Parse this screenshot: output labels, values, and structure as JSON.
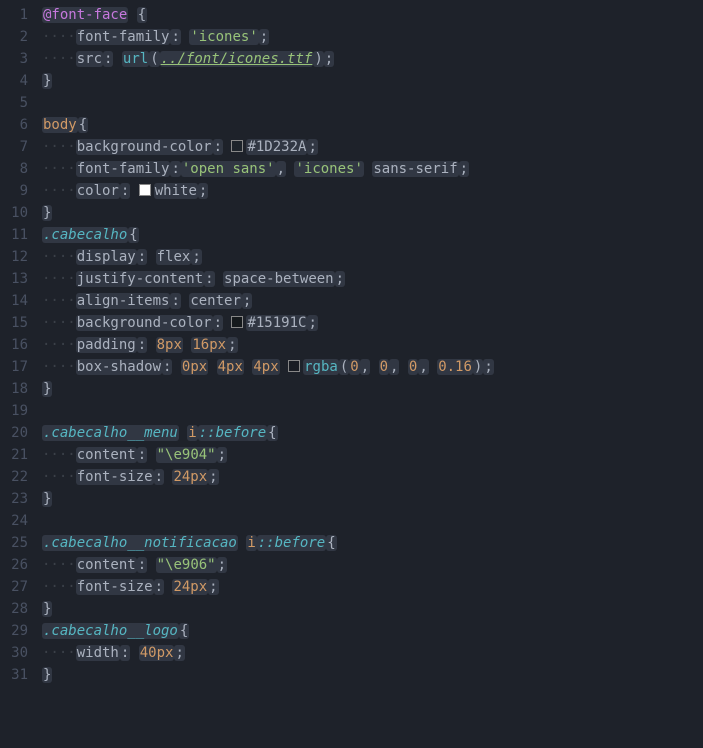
{
  "lines": [
    {
      "n": "1",
      "tokens": [
        {
          "t": "@font-face",
          "c": "kw"
        },
        {
          "t": " ",
          "c": "ws"
        },
        {
          "t": "{",
          "c": "brace"
        }
      ]
    },
    {
      "n": "2",
      "tokens": [
        {
          "t": "····",
          "c": "ws",
          "ind": true
        },
        {
          "t": "font-family",
          "c": "prop"
        },
        {
          "t": ":",
          "c": "punct"
        },
        {
          "t": " ",
          "c": "ws"
        },
        {
          "t": "'icones'",
          "c": "str"
        },
        {
          "t": ";",
          "c": "punct"
        }
      ]
    },
    {
      "n": "3",
      "tokens": [
        {
          "t": "····",
          "c": "ws",
          "ind": true
        },
        {
          "t": "src",
          "c": "prop"
        },
        {
          "t": ":",
          "c": "punct"
        },
        {
          "t": " ",
          "c": "ws"
        },
        {
          "t": "url",
          "c": "fn"
        },
        {
          "t": "(",
          "c": "punct"
        },
        {
          "t": "../font/icones.ttf",
          "c": "url"
        },
        {
          "t": ")",
          "c": "punct"
        },
        {
          "t": ";",
          "c": "punct"
        }
      ]
    },
    {
      "n": "4",
      "tokens": [
        {
          "t": "}",
          "c": "brace"
        }
      ]
    },
    {
      "n": "5",
      "tokens": []
    },
    {
      "n": "6",
      "tokens": [
        {
          "t": "body",
          "c": "sel"
        },
        {
          "t": "{",
          "c": "brace"
        }
      ]
    },
    {
      "n": "7",
      "tokens": [
        {
          "t": "····",
          "c": "ws",
          "ind": true
        },
        {
          "t": "background-color",
          "c": "prop"
        },
        {
          "t": ":",
          "c": "punct"
        },
        {
          "t": " ",
          "c": "ws"
        },
        {
          "sw": "#1D232A"
        },
        {
          "t": "#1D232A",
          "c": "val"
        },
        {
          "t": ";",
          "c": "punct"
        }
      ]
    },
    {
      "n": "8",
      "tokens": [
        {
          "t": "····",
          "c": "ws",
          "ind": true
        },
        {
          "t": "font-family",
          "c": "prop"
        },
        {
          "t": ":",
          "c": "punct"
        },
        {
          "t": "'open sans'",
          "c": "str"
        },
        {
          "t": ",",
          "c": "punct"
        },
        {
          "t": " ",
          "c": "ws"
        },
        {
          "t": "'icones'",
          "c": "str"
        },
        {
          "t": " ",
          "c": "ws"
        },
        {
          "t": "sans-serif",
          "c": "val"
        },
        {
          "t": ";",
          "c": "punct"
        }
      ]
    },
    {
      "n": "9",
      "tokens": [
        {
          "t": "····",
          "c": "ws",
          "ind": true
        },
        {
          "t": "color",
          "c": "prop"
        },
        {
          "t": ":",
          "c": "punct"
        },
        {
          "t": " ",
          "c": "ws"
        },
        {
          "sw": "#ffffff"
        },
        {
          "t": "white",
          "c": "val"
        },
        {
          "t": ";",
          "c": "punct"
        }
      ]
    },
    {
      "n": "10",
      "tokens": [
        {
          "t": "}",
          "c": "brace"
        }
      ]
    },
    {
      "n": "11",
      "tokens": [
        {
          "t": ".cabecalho",
          "c": "class"
        },
        {
          "t": "{",
          "c": "brace"
        }
      ]
    },
    {
      "n": "12",
      "tokens": [
        {
          "t": "····",
          "c": "ws",
          "ind": true
        },
        {
          "t": "display",
          "c": "prop"
        },
        {
          "t": ":",
          "c": "punct"
        },
        {
          "t": " ",
          "c": "ws"
        },
        {
          "t": "flex",
          "c": "val"
        },
        {
          "t": ";",
          "c": "punct"
        }
      ]
    },
    {
      "n": "13",
      "tokens": [
        {
          "t": "····",
          "c": "ws",
          "ind": true
        },
        {
          "t": "justify-content",
          "c": "prop"
        },
        {
          "t": ":",
          "c": "punct"
        },
        {
          "t": " ",
          "c": "ws"
        },
        {
          "t": "space-between",
          "c": "val"
        },
        {
          "t": ";",
          "c": "punct"
        }
      ]
    },
    {
      "n": "14",
      "tokens": [
        {
          "t": "····",
          "c": "ws",
          "ind": true
        },
        {
          "t": "align-items",
          "c": "prop"
        },
        {
          "t": ":",
          "c": "punct"
        },
        {
          "t": " ",
          "c": "ws"
        },
        {
          "t": "center",
          "c": "val"
        },
        {
          "t": ";",
          "c": "punct"
        }
      ]
    },
    {
      "n": "15",
      "tokens": [
        {
          "t": "····",
          "c": "ws",
          "ind": true
        },
        {
          "t": "background-color",
          "c": "prop"
        },
        {
          "t": ":",
          "c": "punct"
        },
        {
          "t": " ",
          "c": "ws"
        },
        {
          "sw": "#15191C"
        },
        {
          "t": "#15191C",
          "c": "val"
        },
        {
          "t": ";",
          "c": "punct"
        }
      ]
    },
    {
      "n": "16",
      "tokens": [
        {
          "t": "····",
          "c": "ws",
          "ind": true
        },
        {
          "t": "padding",
          "c": "prop"
        },
        {
          "t": ":",
          "c": "punct"
        },
        {
          "t": " ",
          "c": "ws"
        },
        {
          "t": "8px",
          "c": "num"
        },
        {
          "t": " ",
          "c": "ws"
        },
        {
          "t": "16px",
          "c": "num"
        },
        {
          "t": ";",
          "c": "punct"
        }
      ]
    },
    {
      "n": "17",
      "tokens": [
        {
          "t": "····",
          "c": "ws",
          "ind": true
        },
        {
          "t": "box-shadow",
          "c": "prop"
        },
        {
          "t": ":",
          "c": "punct"
        },
        {
          "t": " ",
          "c": "ws"
        },
        {
          "t": "0px",
          "c": "num"
        },
        {
          "t": " ",
          "c": "ws"
        },
        {
          "t": "4px",
          "c": "num"
        },
        {
          "t": " ",
          "c": "ws"
        },
        {
          "t": "4px",
          "c": "num"
        },
        {
          "t": " ",
          "c": "ws"
        },
        {
          "sw": "rgba(0,0,0,0.16)"
        },
        {
          "t": "rgba",
          "c": "fn"
        },
        {
          "t": "(",
          "c": "punct"
        },
        {
          "t": "0",
          "c": "num"
        },
        {
          "t": ",",
          "c": "punct"
        },
        {
          "t": " ",
          "c": "ws"
        },
        {
          "t": "0",
          "c": "num"
        },
        {
          "t": ",",
          "c": "punct"
        },
        {
          "t": " ",
          "c": "ws"
        },
        {
          "t": "0",
          "c": "num"
        },
        {
          "t": ",",
          "c": "punct"
        },
        {
          "t": " ",
          "c": "ws"
        },
        {
          "t": "0.16",
          "c": "num"
        },
        {
          "t": ")",
          "c": "punct"
        },
        {
          "t": ";",
          "c": "punct"
        }
      ]
    },
    {
      "n": "18",
      "tokens": [
        {
          "t": "}",
          "c": "brace"
        }
      ]
    },
    {
      "n": "19",
      "tokens": []
    },
    {
      "n": "20",
      "tokens": [
        {
          "t": ".cabecalho__menu",
          "c": "class"
        },
        {
          "t": " ",
          "c": "ws"
        },
        {
          "t": "i",
          "c": "sel"
        },
        {
          "t": "::before",
          "c": "pseudo"
        },
        {
          "t": "{",
          "c": "brace"
        }
      ]
    },
    {
      "n": "21",
      "tokens": [
        {
          "t": "····",
          "c": "ws",
          "ind": true
        },
        {
          "t": "content",
          "c": "prop"
        },
        {
          "t": ":",
          "c": "punct"
        },
        {
          "t": " ",
          "c": "ws"
        },
        {
          "t": "\"\\e904\"",
          "c": "str"
        },
        {
          "t": ";",
          "c": "punct"
        }
      ]
    },
    {
      "n": "22",
      "tokens": [
        {
          "t": "····",
          "c": "ws",
          "ind": true
        },
        {
          "t": "font-size",
          "c": "prop"
        },
        {
          "t": ":",
          "c": "punct"
        },
        {
          "t": " ",
          "c": "ws"
        },
        {
          "t": "24px",
          "c": "num"
        },
        {
          "t": ";",
          "c": "punct"
        }
      ]
    },
    {
      "n": "23",
      "tokens": [
        {
          "t": "}",
          "c": "brace"
        }
      ]
    },
    {
      "n": "24",
      "tokens": []
    },
    {
      "n": "25",
      "tokens": [
        {
          "t": ".cabecalho__notificacao",
          "c": "class"
        },
        {
          "t": " ",
          "c": "ws"
        },
        {
          "t": "i",
          "c": "sel"
        },
        {
          "t": "::before",
          "c": "pseudo"
        },
        {
          "t": "{",
          "c": "brace"
        }
      ]
    },
    {
      "n": "26",
      "tokens": [
        {
          "t": "····",
          "c": "ws",
          "ind": true
        },
        {
          "t": "content",
          "c": "prop"
        },
        {
          "t": ":",
          "c": "punct"
        },
        {
          "t": " ",
          "c": "ws"
        },
        {
          "t": "\"\\e906\"",
          "c": "str"
        },
        {
          "t": ";",
          "c": "punct"
        }
      ]
    },
    {
      "n": "27",
      "tokens": [
        {
          "t": "····",
          "c": "ws",
          "ind": true
        },
        {
          "t": "font-size",
          "c": "prop"
        },
        {
          "t": ":",
          "c": "punct"
        },
        {
          "t": " ",
          "c": "ws"
        },
        {
          "t": "24px",
          "c": "num"
        },
        {
          "t": ";",
          "c": "punct"
        }
      ]
    },
    {
      "n": "28",
      "tokens": [
        {
          "t": "}",
          "c": "brace"
        }
      ]
    },
    {
      "n": "29",
      "tokens": [
        {
          "t": ".cabecalho__logo",
          "c": "class"
        },
        {
          "t": "{",
          "c": "brace"
        }
      ]
    },
    {
      "n": "30",
      "tokens": [
        {
          "t": "····",
          "c": "ws",
          "ind": true
        },
        {
          "t": "width",
          "c": "prop"
        },
        {
          "t": ":",
          "c": "punct"
        },
        {
          "t": " ",
          "c": "ws"
        },
        {
          "t": "40px",
          "c": "num"
        },
        {
          "t": ";",
          "c": "punct"
        }
      ]
    },
    {
      "n": "31",
      "tokens": [
        {
          "t": "}",
          "c": "brace"
        }
      ]
    }
  ]
}
